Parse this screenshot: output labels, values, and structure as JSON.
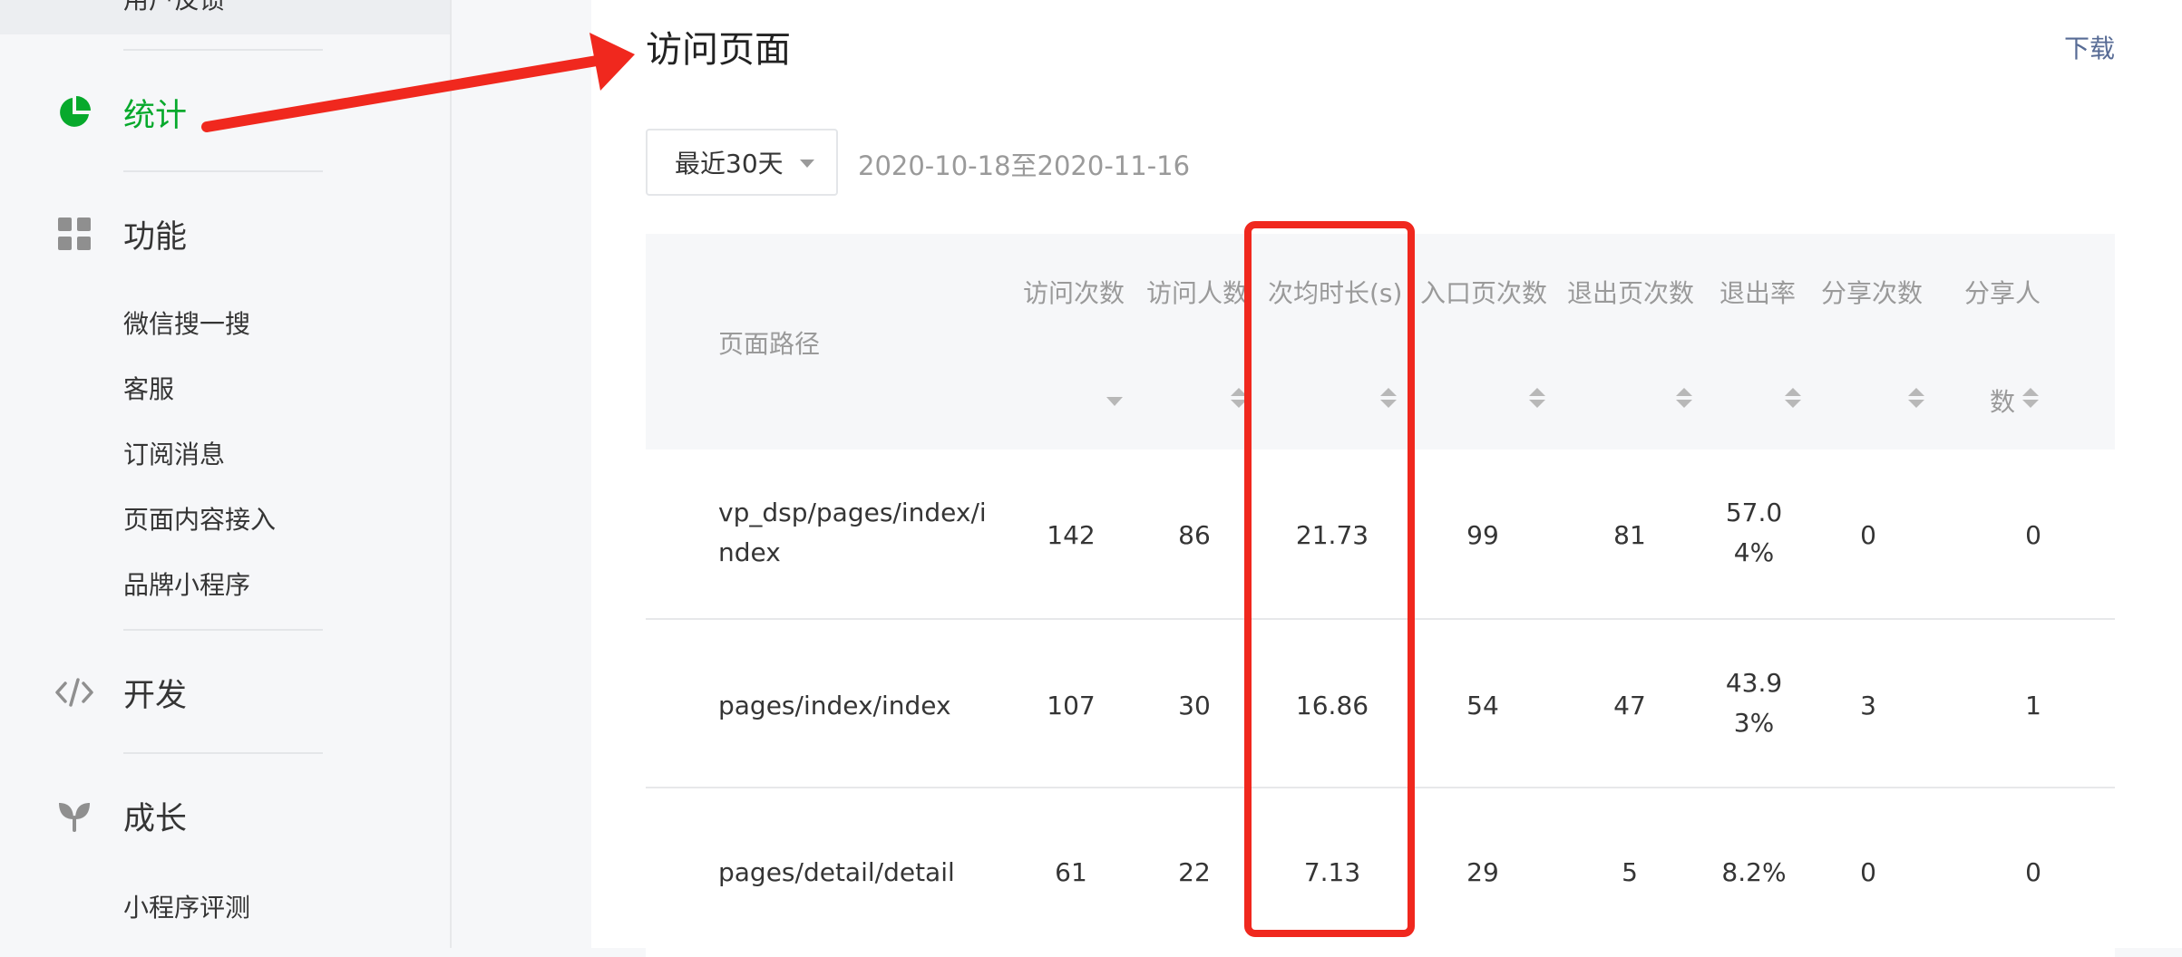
{
  "sidebar": {
    "top_partial_label": "用户反馈",
    "main_items": [
      {
        "label": "统计",
        "icon": "pie-chart-icon",
        "active": true
      },
      {
        "label": "功能",
        "icon": "grid-icon",
        "active": false
      },
      {
        "label": "开发",
        "icon": "code-icon",
        "active": false
      },
      {
        "label": "成长",
        "icon": "sprout-icon",
        "active": false
      }
    ],
    "feature_subitems": [
      "微信搜一搜",
      "客服",
      "订阅消息",
      "页面内容接入",
      "品牌小程序"
    ],
    "growth_subitems": [
      "小程序评测"
    ]
  },
  "page": {
    "title": "访问页面",
    "download_label": "下载",
    "date_select_value": "最近30天",
    "date_range": "2020-10-18至2020-11-16"
  },
  "table": {
    "headers": {
      "path": "页面路径",
      "visits": "访问次数",
      "visitors_1": "访问人数",
      "avg_duration": "次均时长(s)",
      "entry": "入口页次数",
      "exit": "退出页次数",
      "exit_rate": "退出率",
      "share_count": "分享次数",
      "sharers_1": "分享人",
      "sharers_2": "数"
    },
    "rows": [
      {
        "path": "vp_dsp/pages/index/index",
        "visits": "142",
        "visitors": "86",
        "avg_duration": "21.73",
        "entry": "99",
        "exit": "81",
        "exit_rate": "57.04%",
        "share_count": "0",
        "sharers": "0"
      },
      {
        "path": "pages/index/index",
        "visits": "107",
        "visitors": "30",
        "avg_duration": "16.86",
        "entry": "54",
        "exit": "47",
        "exit_rate": "43.93%",
        "share_count": "3",
        "sharers": "1"
      },
      {
        "path": "pages/detail/detail",
        "visits": "61",
        "visitors": "22",
        "avg_duration": "7.13",
        "entry": "29",
        "exit": "5",
        "exit_rate": "8.2%",
        "share_count": "0",
        "sharers": "0"
      }
    ]
  },
  "colors": {
    "accent_green": "#07a92c",
    "link_blue": "#576b95",
    "annotation_red": "#f0281e"
  }
}
